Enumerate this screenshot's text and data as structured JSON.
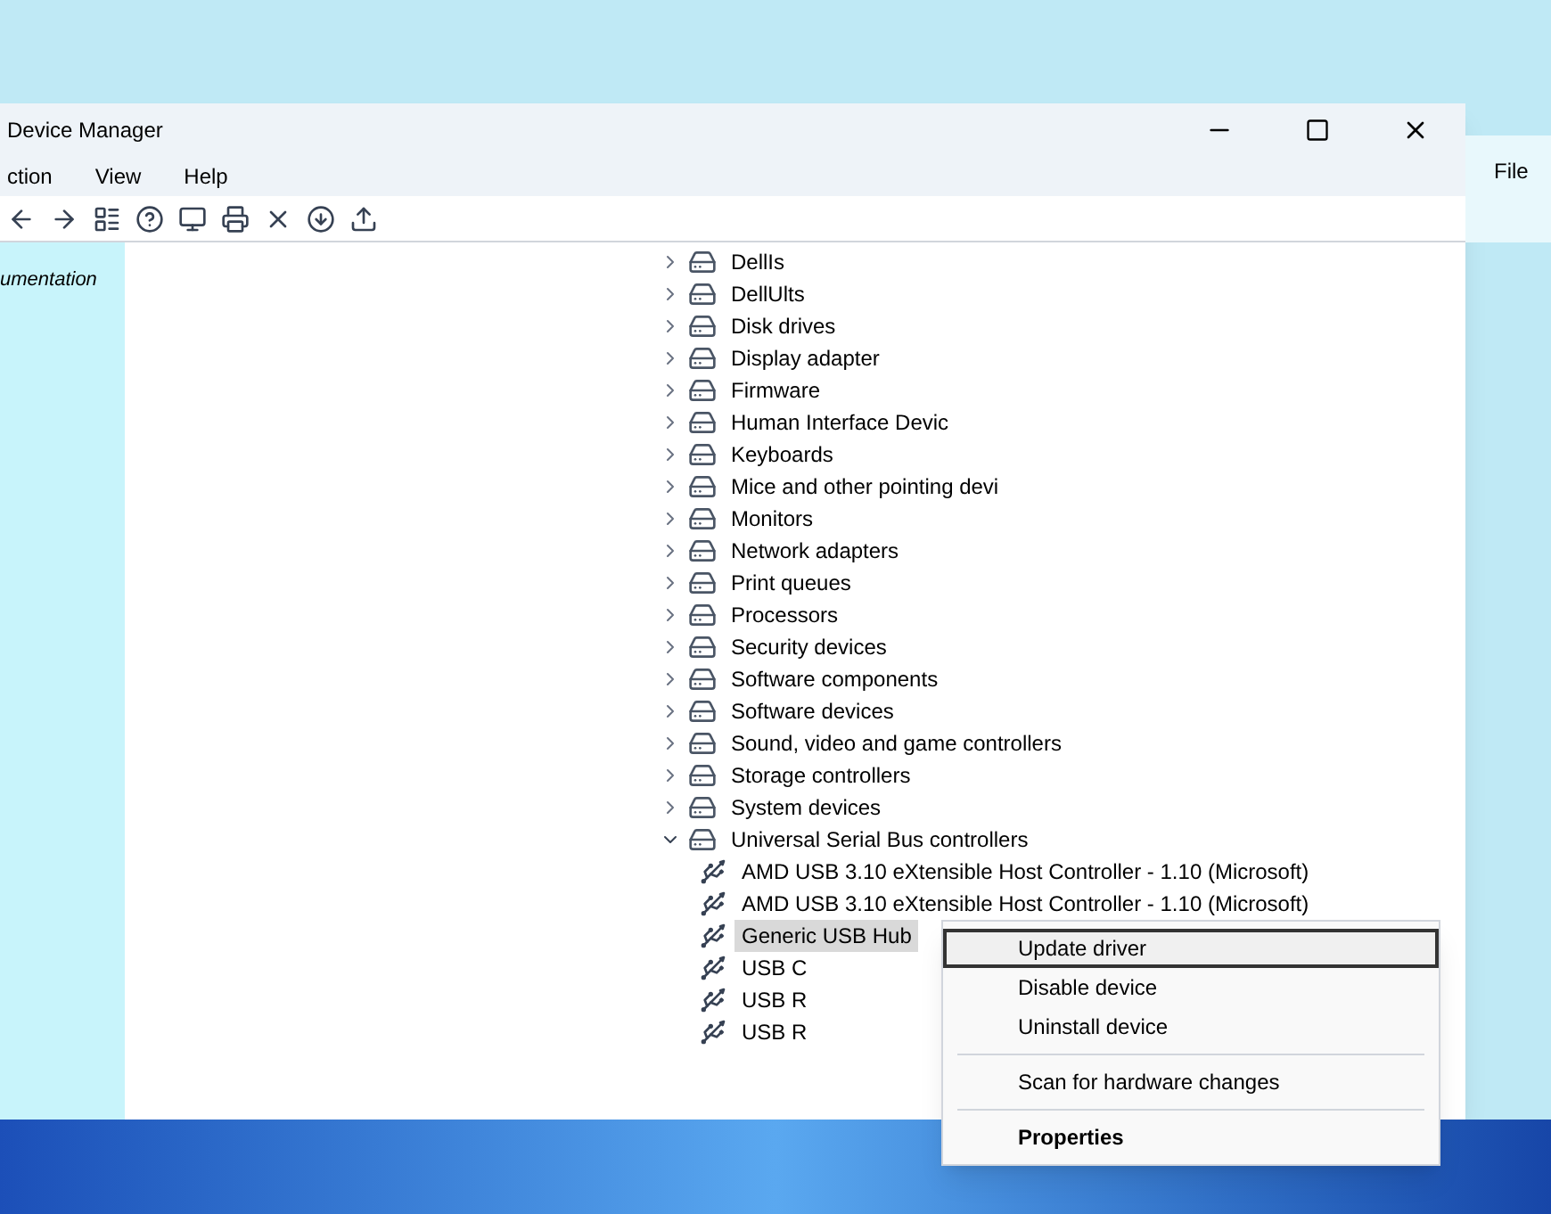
{
  "window": {
    "title": "Device Manager",
    "menu": [
      {
        "label": "ction"
      },
      {
        "label": "View"
      },
      {
        "label": "Help"
      }
    ]
  },
  "side_panel": {
    "text": "umentation"
  },
  "background_window": {
    "menu": "File"
  },
  "tree": [
    {
      "label": "DellIs",
      "expanded": false,
      "selected": false
    },
    {
      "label": "DellUlts",
      "expanded": false,
      "selected": false
    },
    {
      "label": "Disk drives",
      "expanded": false,
      "selected": false
    },
    {
      "label": "Display adapter",
      "expanded": false,
      "selected": false
    },
    {
      "label": "Firmware",
      "expanded": false,
      "selected": false
    },
    {
      "label": "Human Interface Devic",
      "expanded": false,
      "selected": false
    },
    {
      "label": "Keyboards",
      "expanded": false,
      "selected": false
    },
    {
      "label": "Mice and other pointing devi",
      "expanded": false,
      "selected": false
    },
    {
      "label": "Monitors",
      "expanded": false,
      "selected": false
    },
    {
      "label": "Network adapters",
      "expanded": false,
      "selected": false
    },
    {
      "label": "Print queues",
      "expanded": false,
      "selected": false
    },
    {
      "label": "Processors",
      "expanded": false,
      "selected": false
    },
    {
      "label": "Security devices",
      "expanded": false,
      "selected": false
    },
    {
      "label": "Software components",
      "expanded": false,
      "selected": false
    },
    {
      "label": "Software devices",
      "expanded": false,
      "selected": false
    },
    {
      "label": "Sound, video and game controllers",
      "expanded": false,
      "selected": false
    },
    {
      "label": "Storage controllers",
      "expanded": false,
      "selected": false
    },
    {
      "label": "System devices",
      "expanded": false,
      "selected": false
    },
    {
      "label": "Universal Serial Bus controllers",
      "expanded": true,
      "selected": false,
      "children": [
        {
          "label": "AMD USB 3.10 eXtensible Host Controller - 1.10 (Microsoft)",
          "selected": false
        },
        {
          "label": "AMD USB 3.10 eXtensible Host Controller - 1.10 (Microsoft)",
          "selected": false
        },
        {
          "label": "Generic USB Hub",
          "selected": true
        },
        {
          "label": "USB C",
          "selected": false
        },
        {
          "label": "USB R",
          "selected": false
        },
        {
          "label": "USB R",
          "selected": false
        }
      ]
    }
  ],
  "context_menu": {
    "items": [
      {
        "kind": "item",
        "label": "Update driver",
        "selected": true
      },
      {
        "kind": "item",
        "label": "Disable device",
        "selected": false
      },
      {
        "kind": "item",
        "label": "Uninstall device",
        "selected": false
      },
      {
        "kind": "separator"
      },
      {
        "kind": "item",
        "label": "Scan for hardware changes",
        "selected": false
      },
      {
        "kind": "separator"
      },
      {
        "kind": "default",
        "label": "Properties",
        "selected": false
      }
    ]
  }
}
